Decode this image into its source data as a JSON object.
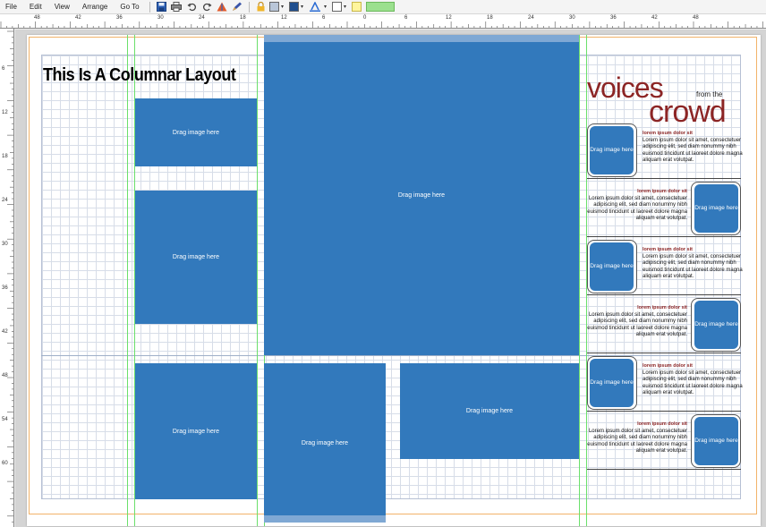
{
  "menu": {
    "file": "File",
    "edit": "Edit",
    "view": "View",
    "arrange": "Arrange",
    "goto": "Go To"
  },
  "toolbar": {
    "icons": [
      "save-icon",
      "print-icon",
      "undo-icon",
      "redo-icon",
      "align-icon",
      "pen-icon",
      "lock-icon",
      "fill-color-icon",
      "line-color-icon",
      "text-color-icon",
      "border-icon",
      "note-icon"
    ],
    "colors": {
      "fill": "#b9c6d8",
      "line": "#1f4f8f",
      "text": "#2a6bd3",
      "border": "#ffffff",
      "note": "#fff59d",
      "progress": "#9be08e"
    }
  },
  "ruler": {
    "top_labels": [
      "48",
      "42",
      "36",
      "30",
      "24",
      "18",
      "12",
      "6",
      "0",
      "6",
      "12",
      "18",
      "24",
      "30",
      "36",
      "42",
      "48"
    ],
    "left_labels": [
      "6",
      "12",
      "18",
      "24",
      "30",
      "36",
      "42",
      "48",
      "54",
      "60"
    ]
  },
  "page": {
    "title": "This Is A Columnar Layout",
    "placeholder_label": "Drag image here"
  },
  "voices": {
    "voices": "voices",
    "from_the": "from the",
    "crowd": "crowd"
  },
  "testimonials": [
    {
      "heading": "lorem ipsum dolor sit",
      "body": "Lorem ipsum dolor sit amet, consectetuer adipiscing elit, sed diam nonummy nibh euismod tincidunt ut laoreet dolore magna aliquam erat volutpat.",
      "photo": "Drag image here"
    },
    {
      "heading": "lorem ipsum dolor sit",
      "body": "Lorem ipsum dolor sit amet, consectetuer adipiscing elit, sed diam nonummy nibh euismod tincidunt ut laoreet dolore magna aliquam erat volutpat.",
      "photo": "Drag image here"
    },
    {
      "heading": "lorem ipsum dolor sit",
      "body": "Lorem ipsum dolor sit amet, consectetuer adipiscing elit, sed diam nonummy nibh euismod tincidunt ut laoreet dolore magna aliquam erat volutpat.",
      "photo": "Drag image here"
    },
    {
      "heading": "lorem ipsum dolor sit",
      "body": "Lorem ipsum dolor sit amet, consectetuer adipiscing elit, sed diam nonummy nibh euismod tincidunt ut laoreet dolore magna aliquam erat volutpat.",
      "photo": "Drag image here"
    },
    {
      "heading": "lorem ipsum dolor sit",
      "body": "Lorem ipsum dolor sit amet, consectetuer adipiscing elit, sed diam nonummy nibh euismod tincidunt ut laoreet dolore magna aliquam erat volutpat.",
      "photo": "Drag image here"
    },
    {
      "heading": "lorem ipsum dolor sit",
      "body": "Lorem ipsum dolor sit amet, consectetuer adipiscing elit, sed diam nonummy nibh euismod tincidunt ut laoreet dolore magna aliquam erat volutpat.",
      "photo": "Drag image here"
    }
  ]
}
